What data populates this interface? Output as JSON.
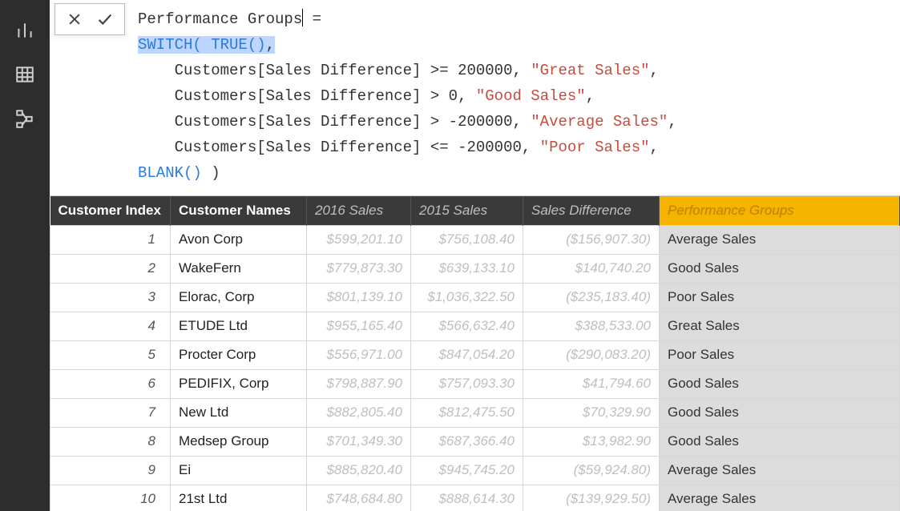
{
  "nav": {
    "items": [
      {
        "name": "report-view-icon"
      },
      {
        "name": "data-view-icon"
      },
      {
        "name": "model-view-icon"
      }
    ]
  },
  "formula": {
    "line1_a": "Performance Groups",
    "line1_b": " =",
    "switch": "SWITCH(",
    "true": " TRUE()",
    "comma": ",",
    "cond1_a": "    Customers[Sales Difference] >= 200000, ",
    "cond1_str": "\"Great Sales\"",
    "cond2_a": "    Customers[Sales Difference] > 0, ",
    "cond2_str": "\"Good Sales\"",
    "cond3_a": "    Customers[Sales Difference] > -200000, ",
    "cond3_str": "\"Average Sales\"",
    "cond4_a": "    Customers[Sales Difference] <= -200000, ",
    "cond4_str": "\"Poor Sales\"",
    "blank": "BLANK()",
    "close": " )"
  },
  "table": {
    "headers": {
      "idx": "Customer Index",
      "name": "Customer Names",
      "s2016": "2016 Sales",
      "s2015": "2015 Sales",
      "diff": "Sales Difference",
      "perf": "Performance Groups"
    },
    "rows": [
      {
        "idx": "1",
        "name": "Avon Corp",
        "s2016": "$599,201.10",
        "s2015": "$756,108.40",
        "diff": "($156,907.30)",
        "perf": "Average Sales"
      },
      {
        "idx": "2",
        "name": "WakeFern",
        "s2016": "$779,873.30",
        "s2015": "$639,133.10",
        "diff": "$140,740.20",
        "perf": "Good Sales"
      },
      {
        "idx": "3",
        "name": "Elorac, Corp",
        "s2016": "$801,139.10",
        "s2015": "$1,036,322.50",
        "diff": "($235,183.40)",
        "perf": "Poor Sales"
      },
      {
        "idx": "4",
        "name": "ETUDE Ltd",
        "s2016": "$955,165.40",
        "s2015": "$566,632.40",
        "diff": "$388,533.00",
        "perf": "Great Sales"
      },
      {
        "idx": "5",
        "name": "Procter Corp",
        "s2016": "$556,971.00",
        "s2015": "$847,054.20",
        "diff": "($290,083.20)",
        "perf": "Poor Sales"
      },
      {
        "idx": "6",
        "name": "PEDIFIX, Corp",
        "s2016": "$798,887.90",
        "s2015": "$757,093.30",
        "diff": "$41,794.60",
        "perf": "Good Sales"
      },
      {
        "idx": "7",
        "name": "New Ltd",
        "s2016": "$882,805.40",
        "s2015": "$812,475.50",
        "diff": "$70,329.90",
        "perf": "Good Sales"
      },
      {
        "idx": "8",
        "name": "Medsep Group",
        "s2016": "$701,349.30",
        "s2015": "$687,366.40",
        "diff": "$13,982.90",
        "perf": "Good Sales"
      },
      {
        "idx": "9",
        "name": "Ei",
        "s2016": "$885,820.40",
        "s2015": "$945,745.20",
        "diff": "($59,924.80)",
        "perf": "Average Sales"
      },
      {
        "idx": "10",
        "name": "21st Ltd",
        "s2016": "$748,684.80",
        "s2015": "$888,614.30",
        "diff": "($139,929.50)",
        "perf": "Average Sales"
      }
    ]
  }
}
